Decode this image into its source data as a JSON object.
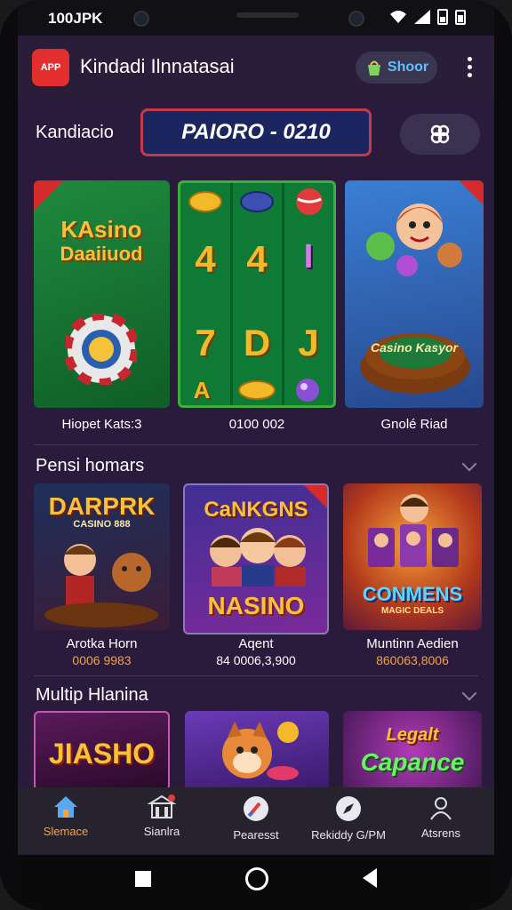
{
  "status_bar": {
    "time": "100JPK"
  },
  "app_bar": {
    "logo_text": "APP",
    "title": "Kindadi Ilnnatasai",
    "shop_label": "Shoor"
  },
  "header": {
    "label": "Kandiacio",
    "promo_code": "PAIORO - 0210"
  },
  "featured": [
    {
      "title_line1": "KAsino",
      "title_line2": "Daaiiuod",
      "caption": "Hiopet Kats:3"
    },
    {
      "caption": "0100 002",
      "reels": [
        "4",
        "4",
        "I",
        "7",
        "D",
        "J",
        "A"
      ]
    },
    {
      "caption": "Gnolé Riad",
      "badge": "Casino Kasyor"
    }
  ],
  "section1": {
    "title": "Pensi homars",
    "cards": [
      {
        "art_title": "DARPRK",
        "art_sub": "CASINO 888",
        "name": "Arotka Horn",
        "value": "0006 9983"
      },
      {
        "art_title": "CaNKGNS",
        "art_sub": "NASINO",
        "name": "Aqent",
        "value": "84 0006,3,900"
      },
      {
        "art_title": "CONMENS",
        "art_sub": "MAGIC DEALS",
        "name": "Muntinn Aedien",
        "value": "860063,8006"
      }
    ]
  },
  "section2": {
    "title": "Multip Hlanina",
    "cards": [
      {
        "art_title": "JIASHO"
      },
      {
        "art_title": ""
      },
      {
        "art_title": "Capance",
        "art_sub": "Legalt"
      }
    ]
  },
  "bottom_nav": [
    {
      "label": "Slemace",
      "icon": "home-icon",
      "active": true
    },
    {
      "label": "Sianlra",
      "icon": "store-icon",
      "active": false
    },
    {
      "label": "Pearesst",
      "icon": "brush-icon",
      "active": false
    },
    {
      "label": "Rekiddy G/PM",
      "icon": "compass-icon",
      "active": false
    },
    {
      "label": "Atsrens",
      "icon": "user-icon",
      "active": false
    }
  ],
  "colors": {
    "accent": "#f4a341",
    "brand": "#e42f2f",
    "background": "#2a1a3c",
    "active_nav": "#f4a341"
  }
}
